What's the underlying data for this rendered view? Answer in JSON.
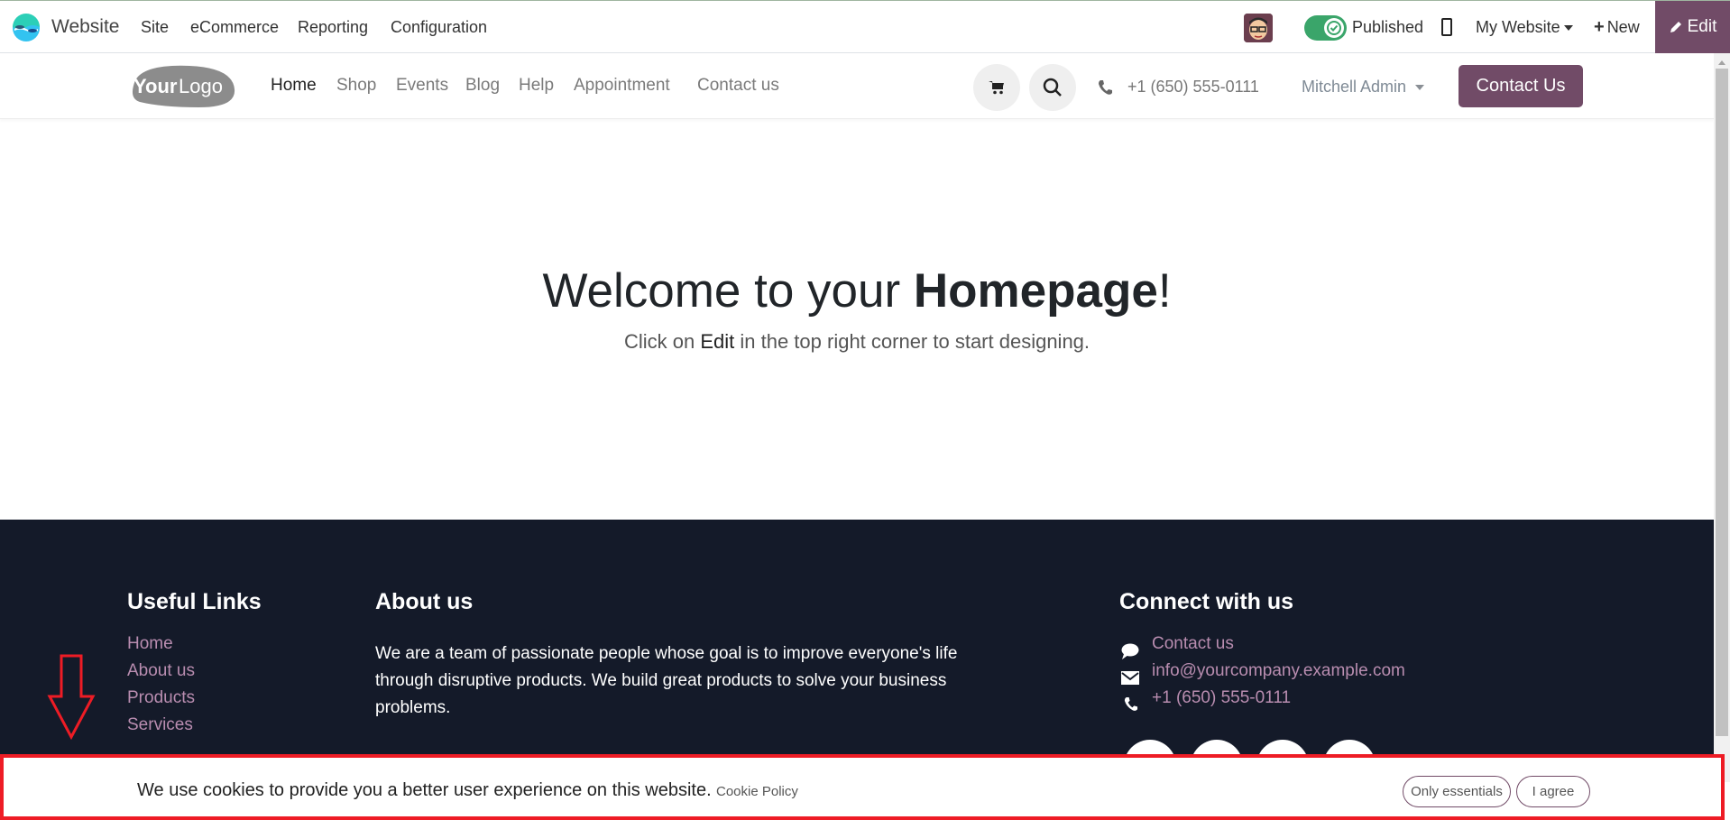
{
  "topbar": {
    "app_name": "Website",
    "menus": [
      "Site",
      "eCommerce",
      "Reporting",
      "Configuration"
    ],
    "published_label": "Published",
    "published_state": true,
    "website_selector": "My Website",
    "new_label": "New",
    "edit_label": "Edit",
    "accent_color": "#714b67"
  },
  "header": {
    "logo_text_bold": "Your",
    "logo_text_light": "Logo",
    "nav": [
      {
        "label": "Home",
        "active": true
      },
      {
        "label": "Shop",
        "active": false
      },
      {
        "label": "Events",
        "active": false
      },
      {
        "label": "Blog",
        "active": false
      },
      {
        "label": "Help",
        "active": false
      },
      {
        "label": "Appointment",
        "active": false
      },
      {
        "label": "Contact us",
        "active": false
      }
    ],
    "phone": "+1 (650) 555-0111",
    "user": "Mitchell Admin",
    "cta_label": "Contact Us"
  },
  "hero": {
    "title_regular": "Welcome to your ",
    "title_bold": "Homepage",
    "title_end": "!",
    "sub_before": "Click on ",
    "sub_bold": "Edit",
    "sub_after": " in the top right corner to start designing."
  },
  "footer": {
    "useful_links_title": "Useful Links",
    "useful_links": [
      "Home",
      "About us",
      "Products",
      "Services"
    ],
    "about_title": "About us",
    "about_text": "We are a team of passionate people whose goal is to improve everyone's life through disruptive products. We build great products to solve your business problems.",
    "connect_title": "Connect with us",
    "connect_items": [
      {
        "icon": "comment-icon",
        "label": "Contact us"
      },
      {
        "icon": "envelope-icon",
        "label": "info@yourcompany.example.com"
      },
      {
        "icon": "phone-icon",
        "label": "+1 (650) 555-0111"
      }
    ],
    "background_color": "#141a29",
    "link_color": "#b98db0"
  },
  "cookie_bar": {
    "message": "We use cookies to provide you a better user experience on this website.",
    "policy_link": "Cookie Policy",
    "only_essentials_label": "Only essentials",
    "agree_label": "I agree",
    "highlight_color": "#ee1c25"
  }
}
